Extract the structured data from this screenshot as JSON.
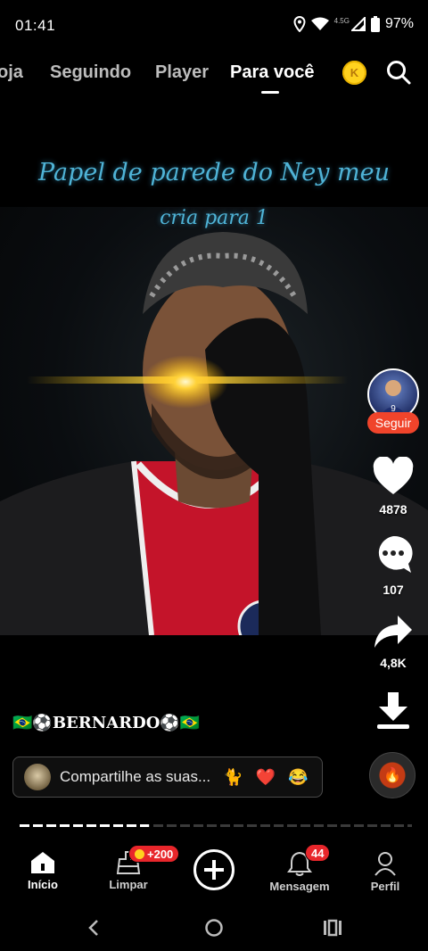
{
  "status_bar": {
    "time": "01:41",
    "network": "4.5G",
    "battery": "97%",
    "icons": [
      "location-icon",
      "wifi-icon",
      "signal-icon",
      "battery-icon"
    ]
  },
  "top_tabs": {
    "items": [
      {
        "label": "oja"
      },
      {
        "label": "Seguindo"
      },
      {
        "label": "Player"
      },
      {
        "label": "Para você",
        "active": true
      }
    ],
    "coin_letter": "K",
    "icons": [
      "coin-icon",
      "search-icon"
    ]
  },
  "video": {
    "caption_line1": "Papel de parede do Ney meu",
    "caption_line2": "cria para 1",
    "username": "🇧🇷⚽BERNARDO⚽🇧🇷"
  },
  "rail": {
    "follow_label": "Seguir",
    "like_count": "4878",
    "comment_count": "107",
    "share_count": "4,8K",
    "icons": [
      "heart-icon",
      "comment-icon",
      "share-icon",
      "download-icon",
      "music-disc-icon"
    ]
  },
  "comment_bar": {
    "placeholder": "Compartilhe as suas...",
    "emojis": [
      "🐈",
      "❤️",
      "😂"
    ]
  },
  "progress": {
    "fraction": 0.33
  },
  "bottom_nav": {
    "items": [
      {
        "label": "Início",
        "icon": "home-icon",
        "active": true
      },
      {
        "label": "Limpar",
        "icon": "clean-icon"
      },
      {
        "label": "",
        "icon": "plus-icon"
      },
      {
        "label": "Mensagem",
        "icon": "bell-icon"
      },
      {
        "label": "Perfil",
        "icon": "profile-icon"
      }
    ],
    "limpar_badge": "+200",
    "message_badge": "44"
  },
  "colors": {
    "accent_red": "#f0442b",
    "badge_red": "#e8262b",
    "caption_blue": "#4fb3d6",
    "coin_yellow": "#ffd21f"
  }
}
